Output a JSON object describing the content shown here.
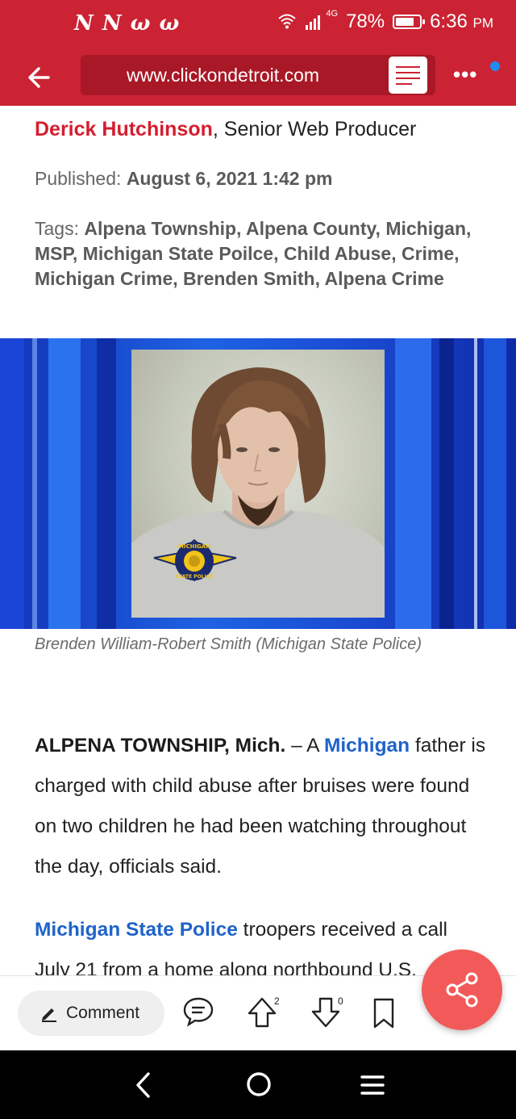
{
  "status_bar": {
    "apps_label": "N N ω ω",
    "network": "4G",
    "battery": "78%",
    "time": "6:36",
    "ampm": "PM"
  },
  "browser": {
    "url": "www.clickondetroit.com"
  },
  "article": {
    "author": "Derick Hutchinson",
    "author_role": ", Senior Web Producer",
    "published_label": "Published:",
    "published_date": "August 6, 2021 1:42 pm",
    "tags_label": "Tags:",
    "tags": "Alpena Township, Alpena County, Michigan, MSP, Michigan State Poilce, Child Abuse, Crime, Michigan Crime, Brenden Smith, Alpena Crime",
    "badge_text_top": "MICHIGAN",
    "badge_text_bottom": "STATE POLICE",
    "caption": "Brenden William-Robert Smith (Michigan State Police)",
    "para1_lead": "ALPENA TOWNSHIP, Mich.",
    "para1_dash": " – A ",
    "para1_link": "Michigan",
    "para1_rest": " father is charged with child abuse after bruises were found on two children he had been watching throughout the day, officials said.",
    "para2_link": "Michigan State Police",
    "para2_rest": " troopers received a call",
    "para2_line2": "July 21 from a home along northbound U.S."
  },
  "actions": {
    "comment_label": "Comment",
    "upvotes": "2",
    "downvotes": "0"
  },
  "colors": {
    "brand_red": "#cb2333",
    "author_red": "#d31f2f",
    "link_blue": "#1f63c9",
    "fab_coral": "#f25a5a"
  },
  "icons": [
    "back-arrow-icon",
    "reader-mode-icon",
    "more-icon",
    "edit-icon",
    "chat-icon",
    "upvote-icon",
    "downvote-icon",
    "bookmark-icon",
    "share-icon",
    "nav-back-icon",
    "nav-home-icon",
    "nav-menu-icon"
  ]
}
